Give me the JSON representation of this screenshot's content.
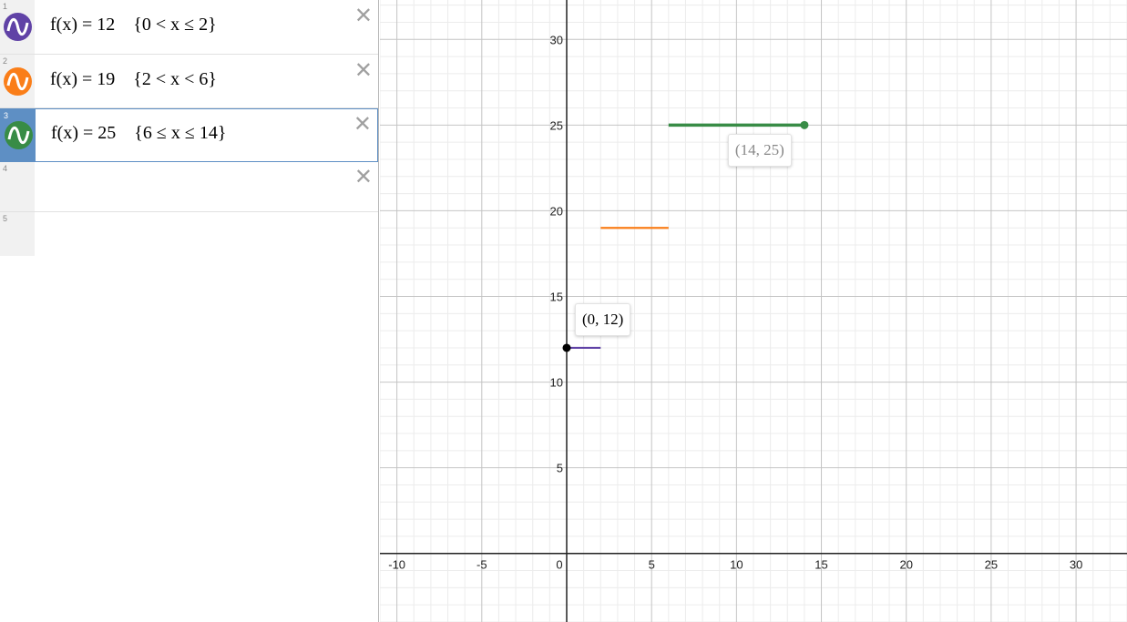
{
  "expressions": [
    {
      "num": "1",
      "text": "f(x) = 12    {0 < x ≤ 2}",
      "color": "#6042a6"
    },
    {
      "num": "2",
      "text": "f(x) = 19    {2 < x < 6}",
      "color": "#fa7e19"
    },
    {
      "num": "3",
      "text": "f(x) = 25    {6 ≤ x ≤ 14}",
      "color": "#388c46"
    },
    {
      "num": "4",
      "text": ""
    },
    {
      "num": "5",
      "text": ""
    }
  ],
  "close_symbol": "✕",
  "graph": {
    "x_ticks": [
      "-10",
      "-5",
      "0",
      "5",
      "10",
      "15",
      "20",
      "25",
      "30"
    ],
    "y_ticks": [
      "5",
      "10",
      "15",
      "20",
      "25",
      "30"
    ],
    "x_range": [
      -11,
      33
    ],
    "y_range": [
      -4,
      32.3
    ]
  },
  "chart_data": {
    "type": "line",
    "series": [
      {
        "name": "f(x) = 12",
        "x": [
          0,
          2
        ],
        "y": [
          12,
          12
        ],
        "color": "#6042a6"
      },
      {
        "name": "f(x) = 19",
        "x": [
          2,
          6
        ],
        "y": [
          19,
          19
        ],
        "color": "#fa7e19"
      },
      {
        "name": "f(x) = 25",
        "x": [
          6,
          14
        ],
        "y": [
          25,
          25
        ],
        "color": "#388c46"
      }
    ],
    "points": [
      {
        "x": 0,
        "y": 12,
        "label": "(0, 12)",
        "color": "#000000"
      },
      {
        "x": 14,
        "y": 25,
        "label": "(14, 25)",
        "color": "#388c46"
      }
    ],
    "grid": true
  }
}
